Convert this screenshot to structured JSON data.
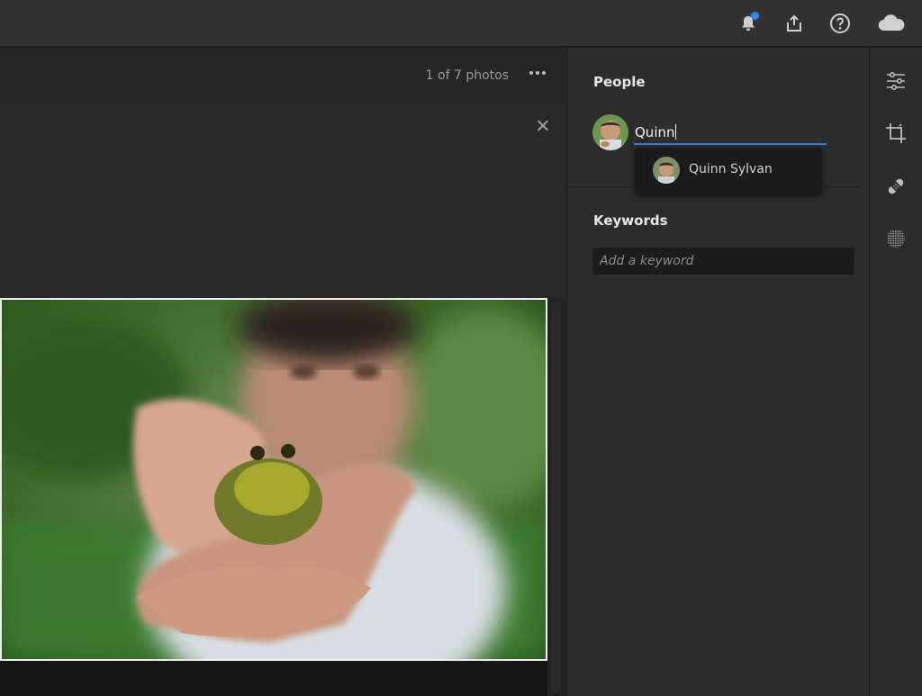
{
  "topbar": {
    "icons": [
      "bell-icon",
      "share-icon",
      "help-icon",
      "cloud-icon"
    ],
    "notification_color": "#2d8ceb"
  },
  "photo_header": {
    "count_label": "1 of 7 photos",
    "more_icon": "ellipsis-icon"
  },
  "people": {
    "title": "People",
    "input_value": "Quinn",
    "suggestion": "Quinn Sylvan"
  },
  "keywords": {
    "title": "Keywords",
    "placeholder": "Add a keyword"
  },
  "toolstrip": {
    "tools": [
      "edit-sliders-icon",
      "crop-icon",
      "healing-icon",
      "masking-icon"
    ]
  },
  "colors": {
    "accent": "#2d7fd8",
    "panel": "#2c2c2c"
  }
}
